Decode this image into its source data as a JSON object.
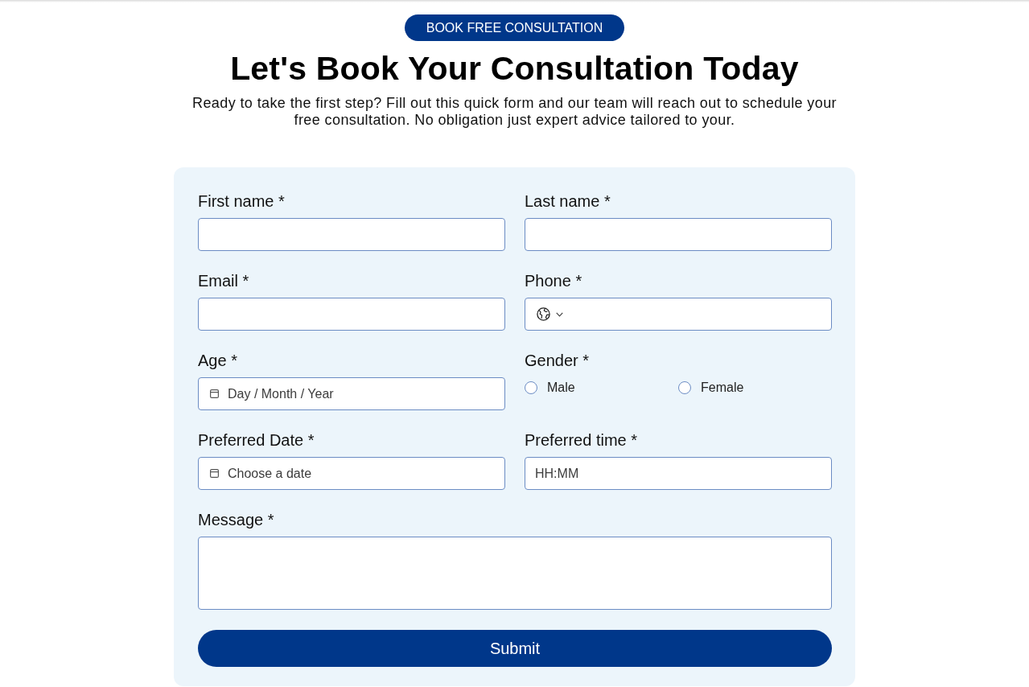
{
  "badge": {
    "label": "BOOK FREE CONSULTATION"
  },
  "heading": "Let's Book Your Consultation Today",
  "intro": "Ready to take the first step? Fill out this quick form and our team will reach out to schedule your free consultation. No obligation just expert advice tailored to your.",
  "form": {
    "fields": [
      {
        "kind": "text",
        "label": "First name *"
      },
      {
        "kind": "text",
        "label": "Last name *"
      },
      {
        "kind": "text",
        "label": "Email *"
      },
      {
        "kind": "phone",
        "label": "Phone *"
      },
      {
        "kind": "date",
        "label": "Age *",
        "placeholder": "Day / Month / Year"
      },
      {
        "kind": "radio",
        "label": "Gender *",
        "options": [
          {
            "label": "Male",
            "selected": false
          },
          {
            "label": "Female",
            "selected": false
          }
        ]
      },
      {
        "kind": "date",
        "label": "Preferred Date *",
        "placeholder": "Choose a date"
      },
      {
        "kind": "text",
        "label": "Preferred time *",
        "placeholder": "HH:MM"
      },
      {
        "kind": "textarea",
        "label": "Message *"
      }
    ],
    "submit": "Submit"
  }
}
